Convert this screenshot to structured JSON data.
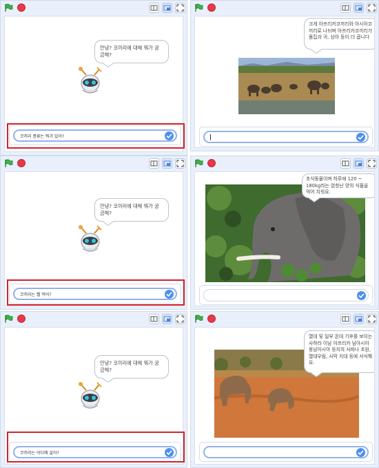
{
  "panels": {
    "left1": {
      "sprite_bubble": "안녕? 코끼리에 대해 뭐가 궁금해?",
      "question": "코끼리 종류는 뭐가 있어?"
    },
    "right1": {
      "answer_bubble": "크게 아프리카코끼리와 아시아코끼리로 나뉘며 아프리카코끼리가 몸집과 귀, 상아 등이 더 큽니다",
      "image_alt": "elephant herd at waterhole"
    },
    "left2": {
      "sprite_bubble": "안녕? 코끼리에 대해 뭐가 궁금해?",
      "question": "코끼리는 뭘 먹어?"
    },
    "right2": {
      "answer_bubble": "초식동물이며 하루에 120 ~ 180kg라는 엄청난 양의 식물을 먹어 치워요.",
      "image_alt": "elephant eating leaves"
    },
    "left3": {
      "sprite_bubble": "안녕? 코끼리에 대해 뭐가 궁금해?",
      "question": "코끼리는 어디에 살아?"
    },
    "right3": {
      "answer_bubble": "열대 및 일부 온대 기후를 보이는 사하라 이남 아프리카 남아시아 동남아시아 등지의 사바나 초원, 열대우림, 사막 지대 등에 서식해요.",
      "image_alt": "two elephants walking on red dirt"
    }
  },
  "colors": {
    "flag_green": "#3db34a",
    "stop_red": "#e8394a",
    "highlight_red": "#d4202a",
    "check_blue": "#4f8ff0",
    "field_border": "#8fb2ef"
  },
  "icons": [
    "green-flag-icon",
    "stop-icon",
    "small-stage-icon",
    "large-stage-icon",
    "fullscreen-icon",
    "check-icon",
    "robot-sprite-icon"
  ]
}
